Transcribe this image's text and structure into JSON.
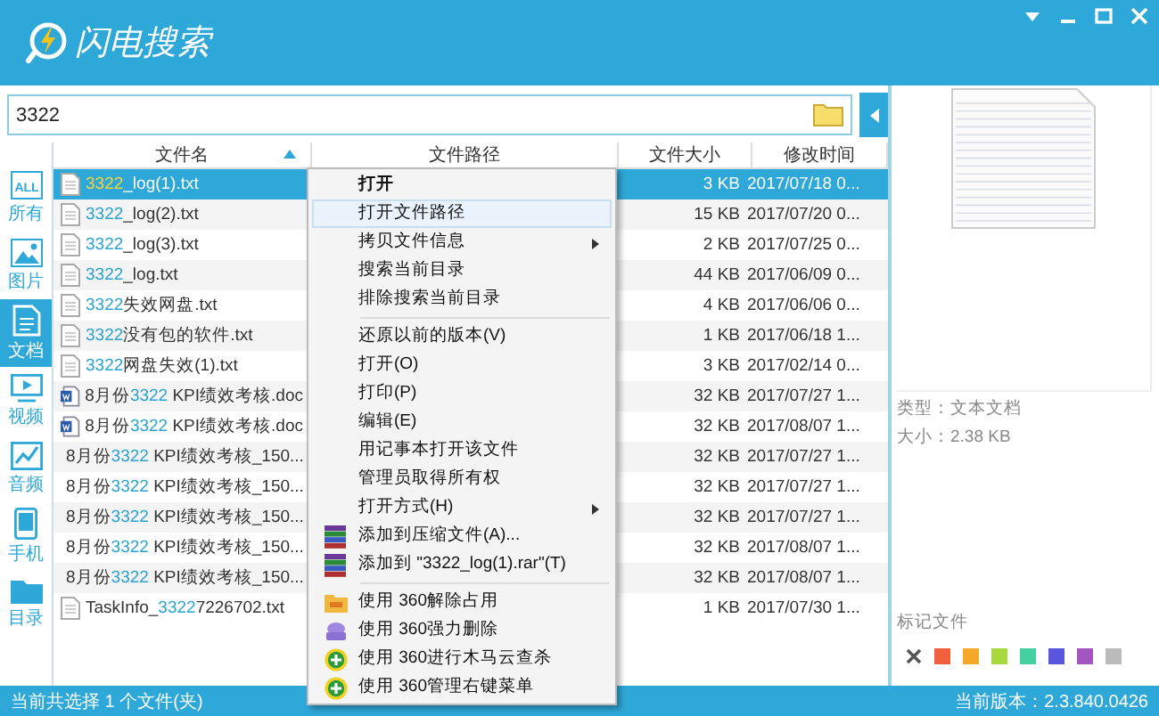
{
  "window": {
    "title": "闪电搜索"
  },
  "search": {
    "value": "3322"
  },
  "categories": [
    {
      "label": "所有",
      "kind": "all",
      "icon_text": "ALL",
      "selected": false
    },
    {
      "label": "图片",
      "kind": "picture",
      "selected": false
    },
    {
      "label": "文档",
      "kind": "doc",
      "selected": true
    },
    {
      "label": "视频",
      "kind": "video",
      "selected": false
    },
    {
      "label": "音频",
      "kind": "audio",
      "selected": false
    },
    {
      "label": "手机",
      "kind": "phone",
      "selected": false
    },
    {
      "label": "目录",
      "kind": "folder",
      "selected": false
    }
  ],
  "table": {
    "columns": [
      {
        "label": "文件名",
        "sorted": true
      },
      {
        "label": "文件路径",
        "sorted": false
      },
      {
        "label": "文件大小",
        "sorted": false
      },
      {
        "label": "修改时间",
        "sorted": false
      }
    ],
    "rows": [
      {
        "kind": "txt",
        "before": "",
        "match": "3322",
        "after": "_log(1).txt",
        "size": "3 KB",
        "modified": "2017/07/18 0...",
        "selected": true
      },
      {
        "kind": "txt",
        "before": "",
        "match": "3322",
        "after": "_log(2).txt",
        "size": "15 KB",
        "modified": "2017/07/20 0...",
        "selected": false
      },
      {
        "kind": "txt",
        "before": "",
        "match": "3322",
        "after": "_log(3).txt",
        "size": "2 KB",
        "modified": "2017/07/25 0...",
        "selected": false
      },
      {
        "kind": "txt",
        "before": "",
        "match": "3322",
        "after": "_log.txt",
        "size": "44 KB",
        "modified": "2017/06/09 0...",
        "selected": false
      },
      {
        "kind": "txt",
        "before": "",
        "match": "3322",
        "after": "失效网盘.txt",
        "size": "4 KB",
        "modified": "2017/06/06 0...",
        "selected": false
      },
      {
        "kind": "txt",
        "before": "",
        "match": "3322",
        "after": "没有包的软件.txt",
        "size": "1 KB",
        "modified": "2017/06/18 1...",
        "selected": false
      },
      {
        "kind": "txt",
        "before": "",
        "match": "3322",
        "after": "网盘失效(1).txt",
        "size": "3 KB",
        "modified": "2017/02/14 0...",
        "selected": false
      },
      {
        "kind": "doc",
        "before": "8月份",
        "match": "3322",
        "after": " KPI绩效考核.doc",
        "size": "32 KB",
        "modified": "2017/07/27 1...",
        "selected": false
      },
      {
        "kind": "doc",
        "before": "8月份",
        "match": "3322",
        "after": " KPI绩效考核.doc",
        "size": "32 KB",
        "modified": "2017/08/07 1...",
        "selected": false
      },
      {
        "kind": "doc",
        "before": "8月份",
        "match": "3322",
        "after": " KPI绩效考核_150...",
        "size": "32 KB",
        "modified": "2017/07/27 1...",
        "selected": false
      },
      {
        "kind": "doc",
        "before": "8月份",
        "match": "3322",
        "after": " KPI绩效考核_150...",
        "size": "32 KB",
        "modified": "2017/07/27 1...",
        "selected": false
      },
      {
        "kind": "doc",
        "before": "8月份",
        "match": "3322",
        "after": " KPI绩效考核_150...",
        "size": "32 KB",
        "modified": "2017/07/27 1...",
        "selected": false
      },
      {
        "kind": "doc",
        "before": "8月份",
        "match": "3322",
        "after": " KPI绩效考核_150...",
        "size": "32 KB",
        "modified": "2017/08/07 1...",
        "selected": false
      },
      {
        "kind": "doc",
        "before": "8月份",
        "match": "3322",
        "after": " KPI绩效考核_150...",
        "size": "32 KB",
        "modified": "2017/08/07 1...",
        "selected": false
      },
      {
        "kind": "txt",
        "before": "TaskInfo_",
        "match": "3322",
        "after": "7226702.txt",
        "size": "1 KB",
        "modified": "2017/07/30 1...",
        "selected": false
      }
    ]
  },
  "context_menu": [
    {
      "label": "打开",
      "kind": "text",
      "bold": true,
      "hovered": false,
      "submenu": false,
      "separator_before": false
    },
    {
      "label": "打开文件路径",
      "kind": "text",
      "bold": false,
      "hovered": true,
      "submenu": false,
      "separator_before": false
    },
    {
      "label": "拷贝文件信息",
      "kind": "text",
      "bold": false,
      "hovered": false,
      "submenu": true,
      "separator_before": false
    },
    {
      "label": "搜索当前目录",
      "kind": "text",
      "bold": false,
      "hovered": false,
      "submenu": false,
      "separator_before": false
    },
    {
      "label": "排除搜索当前目录",
      "kind": "text",
      "bold": false,
      "hovered": false,
      "submenu": false,
      "separator_before": false
    },
    {
      "label": "还原以前的版本(V)",
      "kind": "text",
      "bold": false,
      "hovered": false,
      "submenu": false,
      "separator_before": true
    },
    {
      "label": "打开(O)",
      "kind": "text",
      "bold": false,
      "hovered": false,
      "submenu": false,
      "separator_before": false
    },
    {
      "label": "打印(P)",
      "kind": "text",
      "bold": false,
      "hovered": false,
      "submenu": false,
      "separator_before": false
    },
    {
      "label": "编辑(E)",
      "kind": "text",
      "bold": false,
      "hovered": false,
      "submenu": false,
      "separator_before": false
    },
    {
      "label": "用记事本打开该文件",
      "kind": "text",
      "bold": false,
      "hovered": false,
      "submenu": false,
      "separator_before": false
    },
    {
      "label": "管理员取得所有权",
      "kind": "text",
      "bold": false,
      "hovered": false,
      "submenu": false,
      "separator_before": false
    },
    {
      "label": "打开方式(H)",
      "kind": "text",
      "bold": false,
      "hovered": false,
      "submenu": true,
      "separator_before": false
    },
    {
      "label": "添加到压缩文件(A)...",
      "kind": "archive",
      "bold": false,
      "hovered": false,
      "submenu": false,
      "separator_before": false
    },
    {
      "label": "添加到 \"3322_log(1).rar\"(T)",
      "kind": "archive",
      "bold": false,
      "hovered": false,
      "submenu": false,
      "separator_before": false
    },
    {
      "label": "使用 360解除占用",
      "kind": "unlock",
      "bold": false,
      "hovered": false,
      "submenu": false,
      "separator_before": true
    },
    {
      "label": "使用 360强力删除",
      "kind": "shred",
      "bold": false,
      "hovered": false,
      "submenu": false,
      "separator_before": false
    },
    {
      "label": "使用 360进行木马云查杀",
      "kind": "scan",
      "bold": false,
      "hovered": false,
      "submenu": false,
      "separator_before": false
    },
    {
      "label": "使用 360管理右键菜单",
      "kind": "scan",
      "bold": false,
      "hovered": false,
      "submenu": false,
      "separator_before": false
    }
  ],
  "preview": {
    "type_line": "类型：文本文档",
    "size_line": "大小：2.38 KB",
    "tag_label": "标记文件",
    "tags": [
      {
        "color": "#f0603c"
      },
      {
        "color": "#f5a82a"
      },
      {
        "color": "#a8d840"
      },
      {
        "color": "#44d0a0"
      },
      {
        "color": "#5a55dd"
      },
      {
        "color": "#a455c0"
      },
      {
        "color": "#bbbbbb"
      }
    ]
  },
  "status_bar": {
    "left": "当前共选择 1 个文件(夹)",
    "right": "当前版本：2.3.840.0426"
  }
}
